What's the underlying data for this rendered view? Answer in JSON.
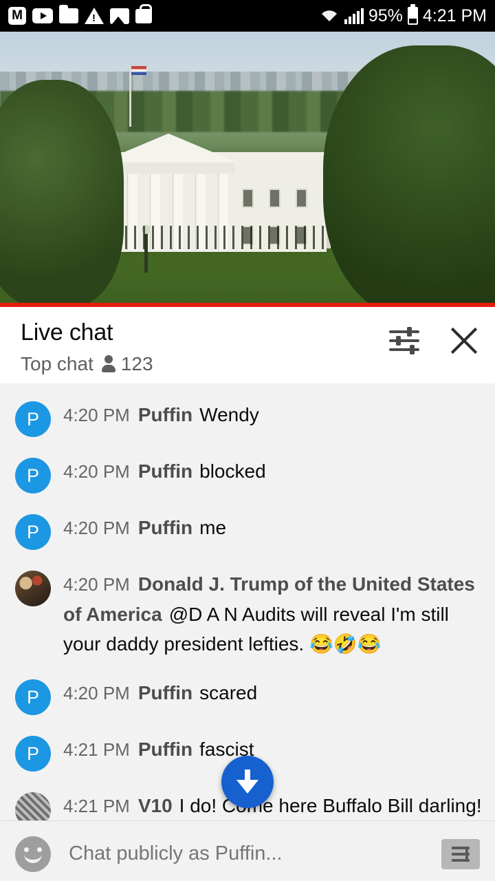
{
  "status_bar": {
    "icons": [
      "m-badge-icon",
      "youtube-icon",
      "folder-icon",
      "warning-icon",
      "photo-icon",
      "bag-icon"
    ],
    "wifi": "wifi-icon",
    "signal": "signal-icon",
    "battery_pct": "95%",
    "battery": "battery-icon",
    "time": "4:21 PM"
  },
  "video": {
    "description": "Live stream of the White House"
  },
  "chat": {
    "title": "Live chat",
    "mode": "Top chat",
    "viewers": "123",
    "filter_icon": "filter-icon",
    "close_icon": "close-icon",
    "messages": [
      {
        "time": "4:20 PM",
        "author": "Puffin",
        "text": "Wendy",
        "avatar": "P",
        "avatar_type": "puffin"
      },
      {
        "time": "4:20 PM",
        "author": "Puffin",
        "text": "blocked",
        "avatar": "P",
        "avatar_type": "puffin"
      },
      {
        "time": "4:20 PM",
        "author": "Puffin",
        "text": "me",
        "avatar": "P",
        "avatar_type": "puffin"
      },
      {
        "time": "4:20 PM",
        "author": "Donald J. Trump of the United States of America",
        "text": "@D A N Audits will reveal I'm still your daddy president lefties. 😂🤣😂",
        "avatar": "",
        "avatar_type": "trump"
      },
      {
        "time": "4:20 PM",
        "author": "Puffin",
        "text": "scared",
        "avatar": "P",
        "avatar_type": "puffin"
      },
      {
        "time": "4:21 PM",
        "author": "Puffin",
        "text": "fascist",
        "avatar": "P",
        "avatar_type": "puffin"
      },
      {
        "time": "4:21 PM",
        "author": "V10",
        "text": "I do! Come here Buffalo Bill darling! 💋",
        "avatar": "",
        "avatar_type": "v10"
      }
    ],
    "scroll_button": "scroll-to-bottom-icon"
  },
  "composer": {
    "emoji_button": "emoji-icon",
    "placeholder": "Chat publicly as Puffin...",
    "value": "",
    "send_button": "send-icon"
  },
  "colors": {
    "accent_blue": "#1660d0",
    "avatar_blue": "#1c97e3",
    "progress_red": "#e81c0f",
    "chat_bg": "#f2f2f2"
  }
}
